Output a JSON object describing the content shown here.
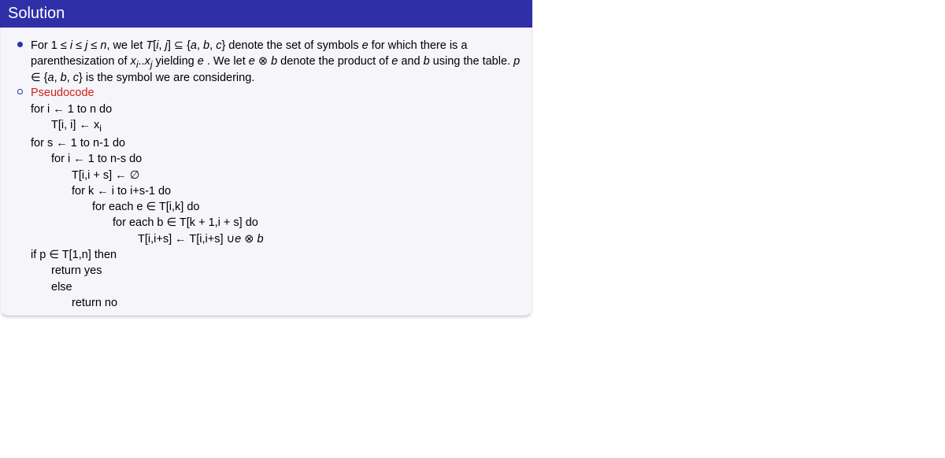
{
  "title": "Solution",
  "bullets": [
    {
      "type": "filled",
      "html": "For 1 ≤ <span class='ital'>i</span> ≤ <span class='ital'>j</span> ≤ <span class='ital'>n</span>, we let <span class='ital'>T</span>[<span class='ital'>i</span>, <span class='ital'>j</span>] ⊆ {<span class='ital'>a</span>, <span class='ital'>b</span>, <span class='ital'>c</span>} denote the set of symbols <span class='ital'>e</span> for which there is a parenthesization of <span class='ital'>x<sub>i</sub></span>..<span class='ital'>x<sub>j</sub></span> yielding <span class='ital'>e</span> . We let <span class='ital'>e</span> ⊗ <span class='ital'>b</span> denote the product of <span class='ital'>e</span> and <span class='ital'>b</span> using the table. <span class='ital'>p</span> ∈ {<span class='ital'>a</span>, <span class='ital'>b</span>, <span class='ital'>c</span>} is the symbol we are considering."
    },
    {
      "type": "hollow",
      "html": "<span class='redtxt'>Pseudocode</span>"
    }
  ],
  "pseudocode": [
    {
      "indent": 0,
      "html": "for i ← 1 to n do"
    },
    {
      "indent": 1,
      "html": "T[i, i] ← x<sub>i</sub>"
    },
    {
      "indent": 0,
      "html": "for s ← 1 to n-1 do"
    },
    {
      "indent": 1,
      "html": "for i ← 1 to n-s do"
    },
    {
      "indent": 2,
      "html": "T[i,i + s] ← ∅"
    },
    {
      "indent": 2,
      "html": "for k ← i to i+s-1 do"
    },
    {
      "indent": 3,
      "html": "for each e ∈ T[i,k] do"
    },
    {
      "indent": 4,
      "html": "for each b ∈ T[k + 1,i + s] do"
    },
    {
      "indent": 5,
      "html": "T[i,i+s] ← T[i,i+s] ∪<span class='ital'>e</span> ⊗ <span class='ital'>b</span>"
    },
    {
      "indent": 0,
      "html": "if p ∈ T[1,n] then"
    },
    {
      "indent": 1,
      "html": "return yes"
    },
    {
      "indent": 1,
      "html": "else"
    },
    {
      "indent": 2,
      "html": "return no"
    }
  ]
}
